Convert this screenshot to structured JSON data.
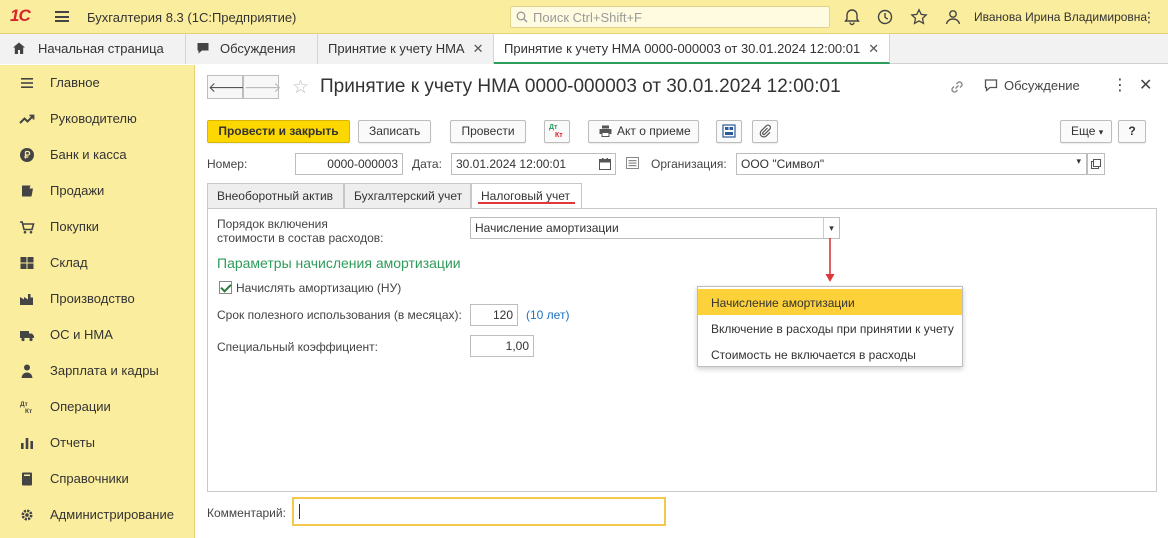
{
  "app": {
    "logo": "1С",
    "title": "Бухгалтерия 8.3  (1С:Предприятие)",
    "search_placeholder": "Поиск Ctrl+Shift+F",
    "user": "Иванова Ирина Владимировна"
  },
  "tabs": [
    {
      "label": "Начальная страница",
      "icon": "home-icon"
    },
    {
      "label": "Обсуждения",
      "icon": "chat-icon"
    },
    {
      "label": "Принятие к учету НМА",
      "close": "✕"
    },
    {
      "label": "Принятие к учету НМА 0000-000003 от 30.01.2024 12:00:01",
      "close": "✕"
    }
  ],
  "sidebar": {
    "items": [
      {
        "label": "Главное",
        "icon": "menu-icon"
      },
      {
        "label": "Руководителю",
        "icon": "trend-icon"
      },
      {
        "label": "Банк и касса",
        "icon": "ruble-icon"
      },
      {
        "label": "Продажи",
        "icon": "cart-icon"
      },
      {
        "label": "Покупки",
        "icon": "basket-icon"
      },
      {
        "label": "Склад",
        "icon": "warehouse-icon"
      },
      {
        "label": "Производство",
        "icon": "factory-icon"
      },
      {
        "label": "ОС и НМА",
        "icon": "truck-icon"
      },
      {
        "label": "Зарплата и кадры",
        "icon": "person-icon"
      },
      {
        "label": "Операции",
        "icon": "dt-kt-icon"
      },
      {
        "label": "Отчеты",
        "icon": "bar-chart-icon"
      },
      {
        "label": "Справочники",
        "icon": "book-icon"
      },
      {
        "label": "Администрирование",
        "icon": "gear-icon"
      }
    ]
  },
  "form": {
    "title": "Принятие к учету НМА 0000-000003 от 30.01.2024 12:00:01",
    "discussion_label": "Обсуждение",
    "toolbar": {
      "post_close": "Провести и закрыть",
      "save": "Записать",
      "post": "Провести",
      "act": "Акт о приеме",
      "more": "Еще",
      "help": "?"
    },
    "number_label": "Номер:",
    "number_value": "0000-000003",
    "date_label": "Дата:",
    "date_value": "30.01.2024 12:00:01",
    "org_label": "Организация:",
    "org_value": "ООО \"Символ\"",
    "form_tabs": [
      "Внеоборотный актив",
      "Бухгалтерский учет",
      "Налоговый учет"
    ],
    "order_label_line1": "Порядок включения",
    "order_label_line2": "стоимости в состав расходов:",
    "order_value": "Начисление амортизации",
    "section_title": "Параметры начисления амортизации",
    "checkbox_label": "Начислять амортизацию (НУ)",
    "checkbox_checked": true,
    "life_label": "Срок полезного использования (в месяцах):",
    "life_value": "120",
    "life_years": "(10 лет)",
    "coef_label": "Специальный коэффициент:",
    "coef_value": "1,00",
    "comment_label": "Комментарий:",
    "comment_value": ""
  },
  "dropdown": {
    "options": [
      "Начисление амортизации",
      "Включение в расходы при принятии к учету",
      "Стоимость не включается в расходы"
    ],
    "selected_index": 0
  },
  "colors": {
    "accent_yellow": "#fbed9e",
    "primary_button": "#fcd700",
    "section_green": "#2e9c5a",
    "arrow_red": "#e0373a",
    "selection": "#fcd13a"
  }
}
